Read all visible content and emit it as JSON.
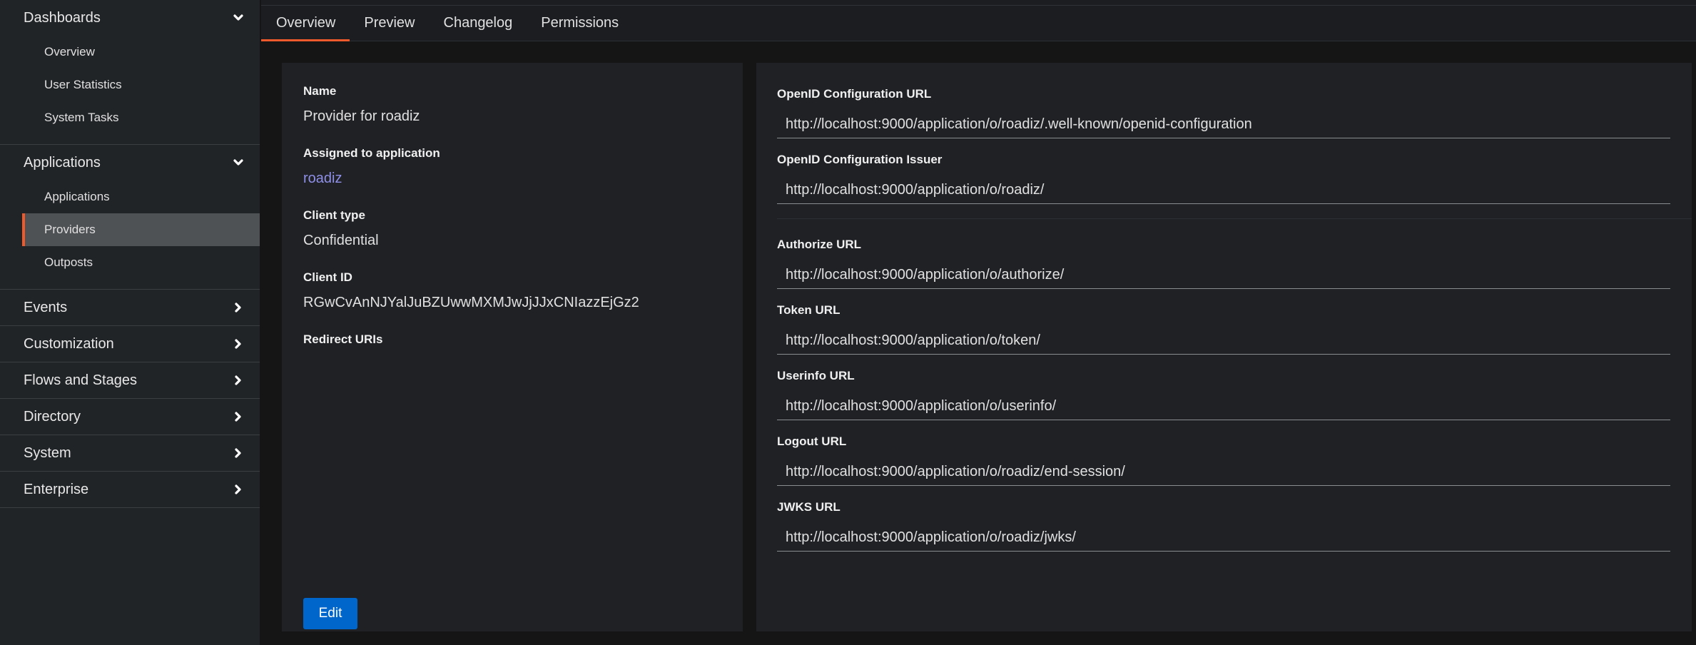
{
  "sidebar": {
    "groups": [
      {
        "label": "Dashboards",
        "expanded": true,
        "items": [
          "Overview",
          "User Statistics",
          "System Tasks"
        ]
      },
      {
        "label": "Applications",
        "expanded": true,
        "items": [
          "Applications",
          "Providers",
          "Outposts"
        ],
        "active_item": "Providers"
      },
      {
        "label": "Events",
        "expanded": false
      },
      {
        "label": "Customization",
        "expanded": false
      },
      {
        "label": "Flows and Stages",
        "expanded": false
      },
      {
        "label": "Directory",
        "expanded": false
      },
      {
        "label": "System",
        "expanded": false
      },
      {
        "label": "Enterprise",
        "expanded": false
      }
    ]
  },
  "tabs": [
    "Overview",
    "Preview",
    "Changelog",
    "Permissions"
  ],
  "active_tab": "Overview",
  "details": {
    "name_label": "Name",
    "name_value": "Provider for roadiz",
    "assigned_label": "Assigned to application",
    "assigned_value": "roadiz",
    "client_type_label": "Client type",
    "client_type_value": "Confidential",
    "client_id_label": "Client ID",
    "client_id_value": "RGwCvAnNJYalJuBZUwwMXMJwJjJJxCNIazzEjGz2",
    "redirect_label": "Redirect URIs",
    "edit_label": "Edit"
  },
  "urls": {
    "openid_config_url": {
      "label": "OpenID Configuration URL",
      "value": "http://localhost:9000/application/o/roadiz/.well-known/openid-configuration"
    },
    "openid_config_issuer": {
      "label": "OpenID Configuration Issuer",
      "value": "http://localhost:9000/application/o/roadiz/"
    },
    "authorize_url": {
      "label": "Authorize URL",
      "value": "http://localhost:9000/application/o/authorize/"
    },
    "token_url": {
      "label": "Token URL",
      "value": "http://localhost:9000/application/o/token/"
    },
    "userinfo_url": {
      "label": "Userinfo URL",
      "value": "http://localhost:9000/application/o/userinfo/"
    },
    "logout_url": {
      "label": "Logout URL",
      "value": "http://localhost:9000/application/o/roadiz/end-session/"
    },
    "jwks_url": {
      "label": "JWKS URL",
      "value": "http://localhost:9000/application/o/roadiz/jwks/"
    }
  },
  "colors": {
    "accent": "#ee5a2c",
    "primary_button": "#0066cc",
    "link": "#8f8fe8"
  },
  "icons": {
    "expanded": "chevron-down-icon",
    "collapsed": "chevron-right-icon"
  }
}
